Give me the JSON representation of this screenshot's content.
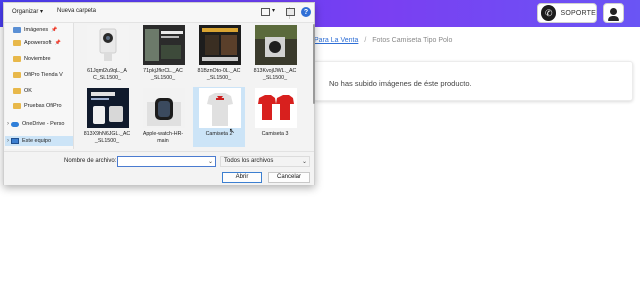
{
  "app": {
    "support_label": "SOPORTE",
    "icons": {
      "support": "whatsapp-icon",
      "user": "user-icon"
    }
  },
  "breadcrumb": {
    "link": "Para La Venta",
    "separator": "/",
    "current": "Fotos Camiseta Tipo Polo"
  },
  "card": {
    "message": "No has subido imágenes de éste producto."
  },
  "dialog": {
    "toolbar": {
      "organize": "Organizar ▾",
      "new_folder": "Nueva carpeta"
    },
    "nav": [
      {
        "label": "Imágenes",
        "icon": "pictures-folder-icon",
        "pinned": true
      },
      {
        "label": "Apowersoft",
        "icon": "folder-icon",
        "pinned": true
      },
      {
        "label": "Noviembre",
        "icon": "folder-icon",
        "pinned": false
      },
      {
        "label": "OfiPro Tienda V",
        "icon": "folder-icon",
        "pinned": false
      },
      {
        "label": "OK",
        "icon": "folder-icon",
        "pinned": false
      },
      {
        "label": "Pruebas OfiPro",
        "icon": "folder-icon",
        "pinned": false
      },
      {
        "label": "OneDrive - Perso",
        "icon": "onedrive-icon",
        "pinned": false
      },
      {
        "label": "Este equipo",
        "icon": "computer-icon",
        "pinned": false
      }
    ],
    "files": [
      {
        "name": "61Jqml2u9qL._A C_SL1500_"
      },
      {
        "name": "71pkjJfkrCL._AC _SL1500_"
      },
      {
        "name": "81BznOto-0L._AC _SL1500_"
      },
      {
        "name": "813KvojlJWL._AC _SL1500_"
      },
      {
        "name": "813X9hN6JGL._AC _SL1500_"
      },
      {
        "name": "Apple-watch-HR- main"
      },
      {
        "name": "Camiseta 2"
      },
      {
        "name": "Camiseta 3"
      }
    ],
    "footer": {
      "filename_label": "Nombre de archivo:",
      "filename_value": "",
      "filetype": "Todos los archivos",
      "open": "Abrir",
      "cancel": "Cancelar"
    }
  }
}
